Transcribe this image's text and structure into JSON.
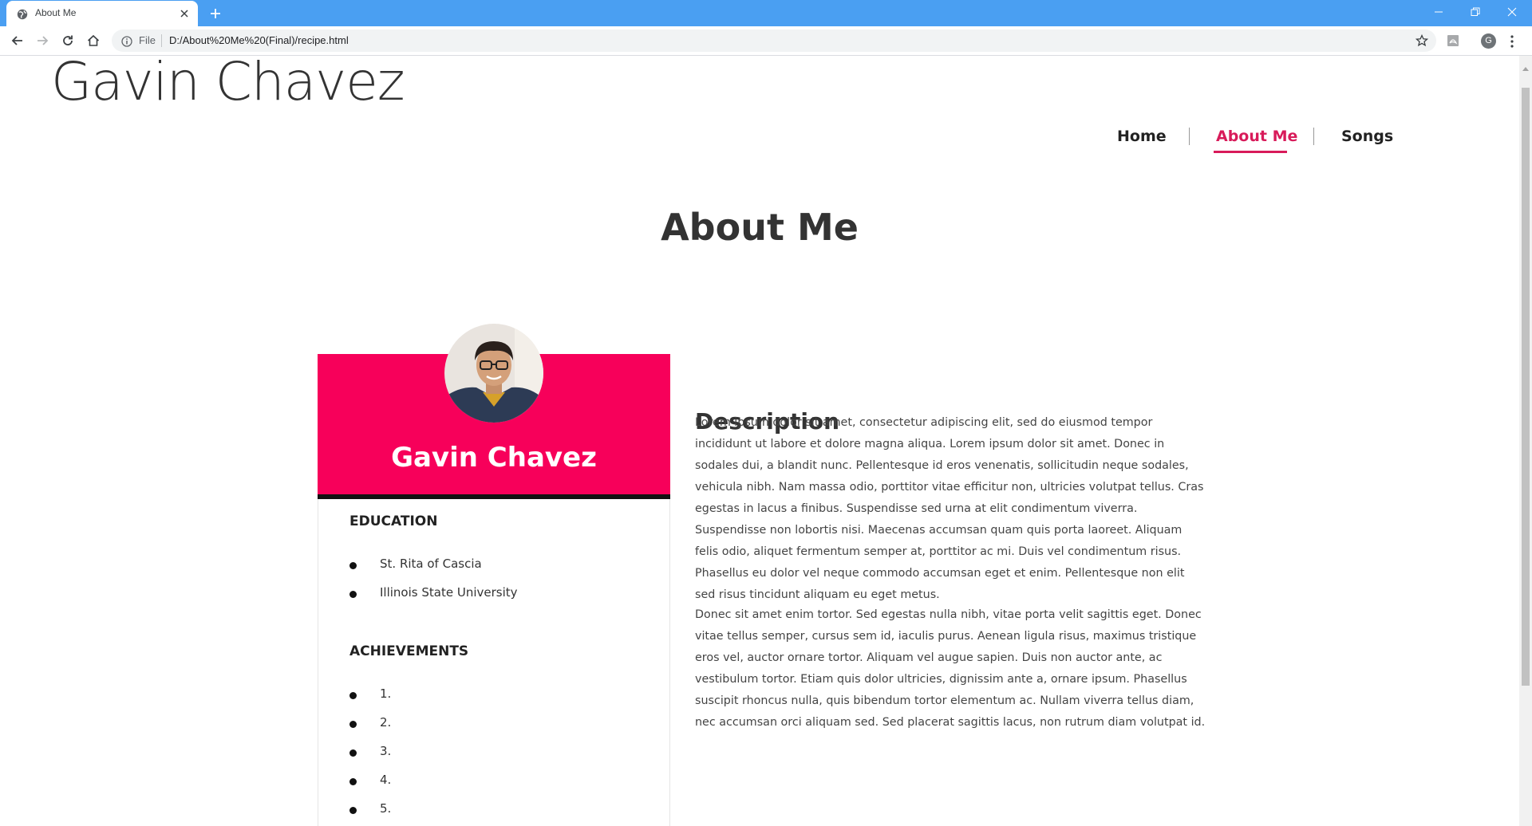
{
  "browser": {
    "tab_title": "About Me",
    "omnibox_scheme": "File",
    "url": "D:/About%20Me%20(Final)/recipe.html",
    "profile_initial": "G"
  },
  "site": {
    "title": "Gavin Chavez",
    "nav": [
      {
        "label": "Home",
        "active": false
      },
      {
        "label": "About Me",
        "active": true
      },
      {
        "label": "Songs",
        "active": false
      }
    ],
    "accent_color": "#d81b5a"
  },
  "page": {
    "heading": "About Me"
  },
  "profile_card": {
    "name": "Gavin Chavez",
    "banner_color": "#f7005a",
    "education_title": "EDUCATION",
    "education": [
      "St. Rita of Cascia",
      "Illinois State University"
    ],
    "achievements_title": "ACHIEVEMENTS",
    "achievements": [
      "1.",
      "2.",
      "3.",
      "4.",
      "5."
    ]
  },
  "description": {
    "title": "Description",
    "paragraphs": [
      "Lorem ipsum dolor sit amet, consectetur adipiscing elit, sed do eiusmod tempor incididunt ut labore et dolore magna aliqua. Lorem ipsum dolor sit amet. Donec in sodales dui, a blandit nunc. Pellentesque id eros venenatis, sollicitudin neque sodales, vehicula nibh. Nam massa odio, porttitor vitae efficitur non, ultricies volutpat tellus. Cras egestas in lacus a finibus. Suspendisse sed urna at elit condimentum viverra. Suspendisse non lobortis nisi. Maecenas accumsan quam quis porta laoreet. Aliquam felis odio, aliquet fermentum semper at, porttitor ac mi. Duis vel condimentum risus. Phasellus eu dolor vel neque commodo accumsan eget et enim. Pellentesque non elit sed risus tincidunt aliquam eu eget metus.",
      "Donec sit amet enim tortor. Sed egestas nulla nibh, vitae porta velit sagittis eget. Donec vitae tellus semper, cursus sem id, iaculis purus. Aenean ligula risus, maximus tristique eros vel, auctor ornare tortor. Aliquam vel augue sapien. Duis non auctor ante, ac vestibulum tortor. Etiam quis dolor ultricies, dignissim ante a, ornare ipsum. Phasellus suscipit rhoncus nulla, quis bibendum tortor elementum ac. Nullam viverra tellus diam, nec accumsan orci aliquam sed. Sed placerat sagittis lacus, non rutrum diam volutpat id."
    ]
  }
}
